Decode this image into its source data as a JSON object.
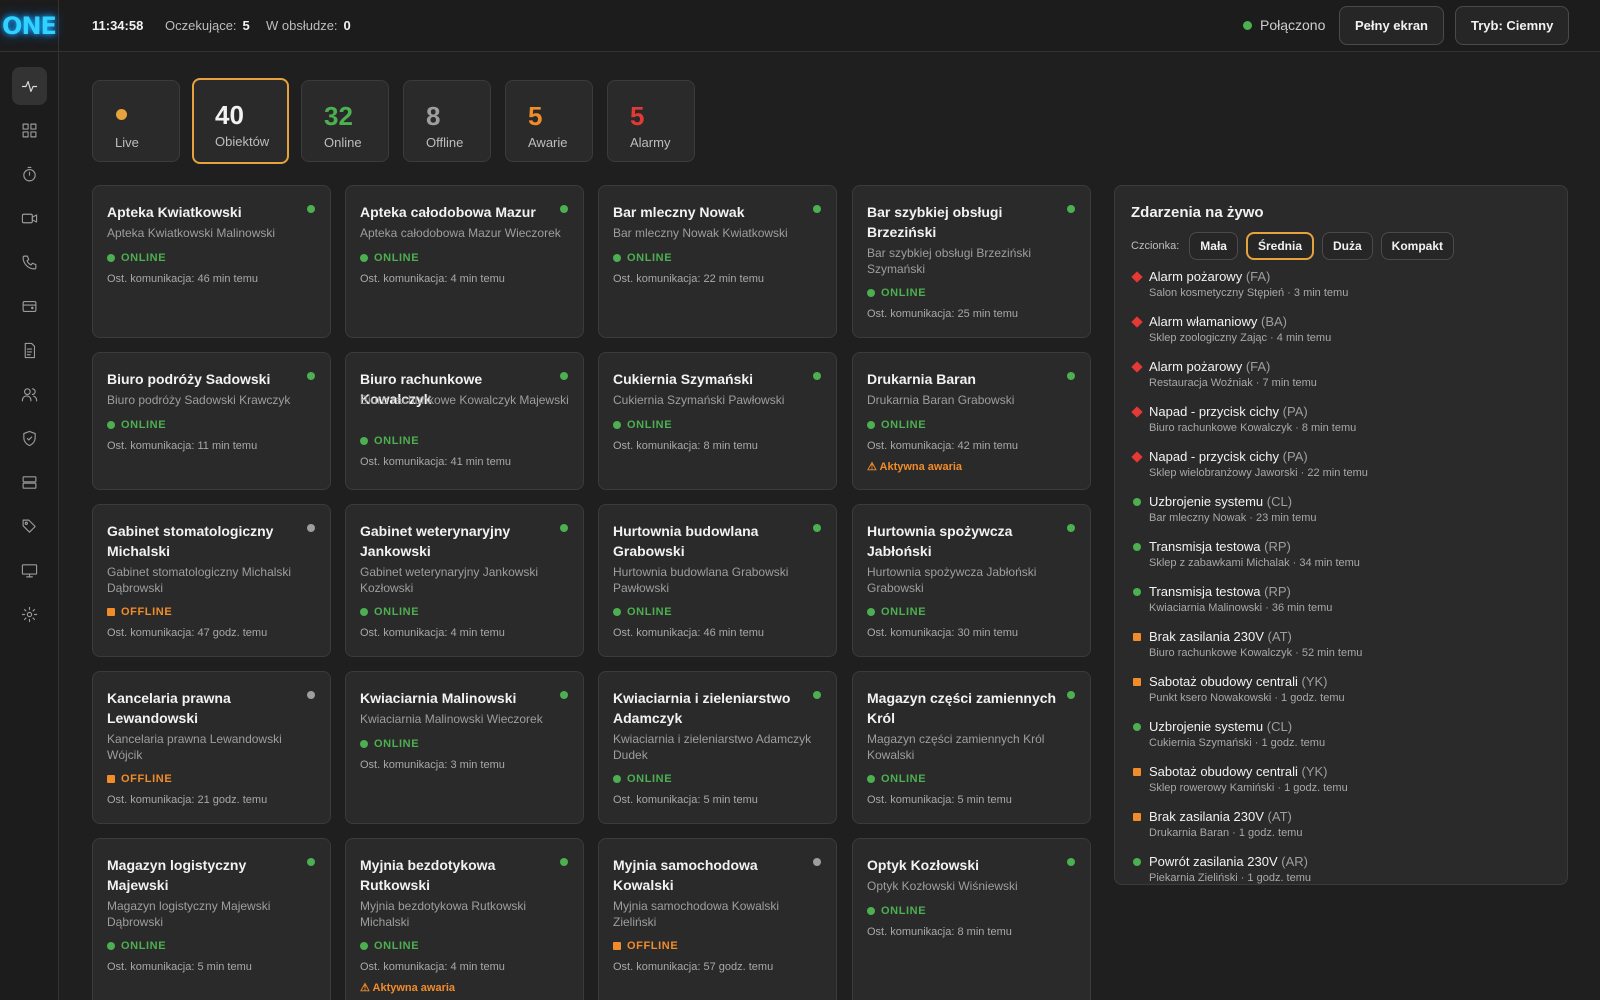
{
  "logo": "ONE",
  "topbar": {
    "clock": "11:34:58",
    "pending_label": "Oczekujące:",
    "pending_count": "5",
    "in_service_label": "W obsłudze:",
    "in_service_count": "0",
    "connection": "Połączono",
    "fullscreen_button": "Pełny ekran",
    "mode_button": "Tryb: Ciemny"
  },
  "sidebar": {
    "items": [
      "activity-icon",
      "dashboard-grid-icon",
      "timer-icon",
      "video-camera-icon",
      "phone-icon",
      "wallet-icon",
      "report-icon",
      "users-icon",
      "shield-icon",
      "server-icon",
      "tag-icon",
      "monitor-icon",
      "settings-icon"
    ]
  },
  "stats": {
    "live_label": "Live",
    "objects_count": "40",
    "objects_label": "Obiektów",
    "online_count": "32",
    "online_label": "Online",
    "offline_count": "8",
    "offline_label": "Offline",
    "failures_count": "5",
    "failures_label": "Awarie",
    "alarms_count": "5",
    "alarms_label": "Alarmy"
  },
  "colors": {
    "accent": "#e6a23c",
    "online": "#4caf50",
    "offline": "#f08c2a",
    "alarm": "#e53935",
    "logo": "#2fd3ff"
  },
  "objects": [
    {
      "title": "Apteka Kwiatkowski",
      "subtitle": "Apteka Kwiatkowski Malinowski",
      "status": "ONLINE",
      "last": "Ost. komunikacja: 46 min temu",
      "alert": ""
    },
    {
      "title": "Apteka całodobowa Mazur",
      "subtitle": "Apteka całodobowa Mazur Wieczorek",
      "status": "ONLINE",
      "last": "Ost. komunikacja: 4 min temu",
      "alert": ""
    },
    {
      "title": "Bar mleczny Nowak",
      "subtitle": "Bar mleczny Nowak Kwiatkowski",
      "status": "ONLINE",
      "last": "Ost. komunikacja: 22 min temu",
      "alert": ""
    },
    {
      "title": "Bar szybkiej obsługi Brzeziński",
      "subtitle": "Bar szybkiej obsługi Brzeziński Szymański",
      "status": "ONLINE",
      "last": "Ost. komunikacja: 25 min temu",
      "alert": ""
    },
    {
      "title": "Biuro podróży Sadowski",
      "subtitle": "Biuro podróży Sadowski Krawczyk",
      "status": "ONLINE",
      "last": "Ost. komunikacja: 11 min temu",
      "alert": ""
    },
    {
      "title": "Biuro rachunkowe Kowalczyk",
      "subtitle": "Biuro rachunkowe Kowalczyk Majewski",
      "status": "ONLINE",
      "last": "Ost. komunikacja: 41 min temu",
      "alert": ""
    },
    {
      "title": "Cukiernia Szymański",
      "subtitle": "Cukiernia Szymański Pawłowski",
      "status": "ONLINE",
      "last": "Ost. komunikacja: 8 min temu",
      "alert": ""
    },
    {
      "title": "Drukarnia Baran",
      "subtitle": "Drukarnia Baran Grabowski",
      "status": "ONLINE",
      "last": "Ost. komunikacja: 42 min temu",
      "alert": "⚠ Aktywna awaria"
    },
    {
      "title": "Gabinet stomatologiczny Michalski",
      "subtitle": "Gabinet stomatologiczny Michalski Dąbrowski",
      "status": "OFFLINE",
      "last": "Ost. komunikacja: 47 godz. temu",
      "alert": ""
    },
    {
      "title": "Gabinet weterynaryjny Jankowski",
      "subtitle": "Gabinet weterynaryjny Jankowski Kozłowski",
      "status": "ONLINE",
      "last": "Ost. komunikacja: 4 min temu",
      "alert": ""
    },
    {
      "title": "Hurtownia budowlana Grabowski",
      "subtitle": "Hurtownia budowlana Grabowski Pawłowski",
      "status": "ONLINE",
      "last": "Ost. komunikacja: 46 min temu",
      "alert": ""
    },
    {
      "title": "Hurtownia spożywcza Jabłoński",
      "subtitle": "Hurtownia spożywcza Jabłoński Grabowski",
      "status": "ONLINE",
      "last": "Ost. komunikacja: 30 min temu",
      "alert": ""
    },
    {
      "title": "Kancelaria prawna Lewandowski",
      "subtitle": "Kancelaria prawna Lewandowski Wójcik",
      "status": "OFFLINE",
      "last": "Ost. komunikacja: 21 godz. temu",
      "alert": ""
    },
    {
      "title": "Kwiaciarnia Malinowski",
      "subtitle": "Kwiaciarnia Malinowski Wieczorek",
      "status": "ONLINE",
      "last": "Ost. komunikacja: 3 min temu",
      "alert": ""
    },
    {
      "title": "Kwiaciarnia i zieleniarstwo Adamczyk",
      "subtitle": "Kwiaciarnia i zieleniarstwo Adamczyk Dudek",
      "status": "ONLINE",
      "last": "Ost. komunikacja: 5 min temu",
      "alert": ""
    },
    {
      "title": "Magazyn części zamiennych Król",
      "subtitle": "Magazyn części zamiennych Król Kowalski",
      "status": "ONLINE",
      "last": "Ost. komunikacja: 5 min temu",
      "alert": ""
    },
    {
      "title": "Magazyn logistyczny Majewski",
      "subtitle": "Magazyn logistyczny Majewski Dąbrowski",
      "status": "ONLINE",
      "last": "Ost. komunikacja: 5 min temu",
      "alert": ""
    },
    {
      "title": "Myjnia bezdotykowa Rutkowski",
      "subtitle": "Myjnia bezdotykowa Rutkowski Michalski",
      "status": "ONLINE",
      "last": "Ost. komunikacja: 4 min temu",
      "alert": "⚠ Aktywna awaria"
    },
    {
      "title": "Myjnia samochodowa Kowalski",
      "subtitle": "Myjnia samochodowa Kowalski Zieliński",
      "status": "OFFLINE",
      "last": "Ost. komunikacja: 57 godz. temu",
      "alert": ""
    },
    {
      "title": "Optyk Kozłowski",
      "subtitle": "Optyk Kozłowski Wiśniewski",
      "status": "ONLINE",
      "last": "Ost. komunikacja: 8 min temu",
      "alert": ""
    }
  ],
  "events": {
    "title": "Zdarzenia na żywo",
    "font_label": "Czcionka:",
    "font_options": [
      "Mała",
      "Średnia",
      "Duża",
      "Kompakt"
    ],
    "font_selected": "Średnia",
    "items": [
      {
        "kind": "alarm",
        "name": "Alarm pożarowy",
        "code": "(FA)",
        "detail": "Salon kosmetyczny Stępień · 3 min temu"
      },
      {
        "kind": "alarm",
        "name": "Alarm włamaniowy",
        "code": "(BA)",
        "detail": "Sklep zoologiczny Zając · 4 min temu"
      },
      {
        "kind": "alarm",
        "name": "Alarm pożarowy",
        "code": "(FA)",
        "detail": "Restauracja Woźniak · 7 min temu"
      },
      {
        "kind": "alarm",
        "name": "Napad - przycisk cichy",
        "code": "(PA)",
        "detail": "Biuro rachunkowe Kowalczyk · 8 min temu"
      },
      {
        "kind": "alarm",
        "name": "Napad - przycisk cichy",
        "code": "(PA)",
        "detail": "Sklep wielobranżowy Jaworski · 22 min temu"
      },
      {
        "kind": "info",
        "name": "Uzbrojenie systemu",
        "code": "(CL)",
        "detail": "Bar mleczny Nowak · 23 min temu"
      },
      {
        "kind": "info",
        "name": "Transmisja testowa",
        "code": "(RP)",
        "detail": "Sklep z zabawkami Michalak · 34 min temu"
      },
      {
        "kind": "info",
        "name": "Transmisja testowa",
        "code": "(RP)",
        "detail": "Kwiaciarnia Malinowski · 36 min temu"
      },
      {
        "kind": "fault",
        "name": "Brak zasilania 230V",
        "code": "(AT)",
        "detail": "Biuro rachunkowe Kowalczyk · 52 min temu"
      },
      {
        "kind": "fault",
        "name": "Sabotaż obudowy centrali",
        "code": "(YK)",
        "detail": "Punkt ksero Nowakowski · 1 godz. temu"
      },
      {
        "kind": "info",
        "name": "Uzbrojenie systemu",
        "code": "(CL)",
        "detail": "Cukiernia Szymański · 1 godz. temu"
      },
      {
        "kind": "fault",
        "name": "Sabotaż obudowy centrali",
        "code": "(YK)",
        "detail": "Sklep rowerowy Kamiński · 1 godz. temu"
      },
      {
        "kind": "fault",
        "name": "Brak zasilania 230V",
        "code": "(AT)",
        "detail": "Drukarnia Baran · 1 godz. temu"
      },
      {
        "kind": "info",
        "name": "Powrót zasilania 230V",
        "code": "(AR)",
        "detail": "Piekarnia Zieliński · 1 godz. temu"
      }
    ]
  }
}
